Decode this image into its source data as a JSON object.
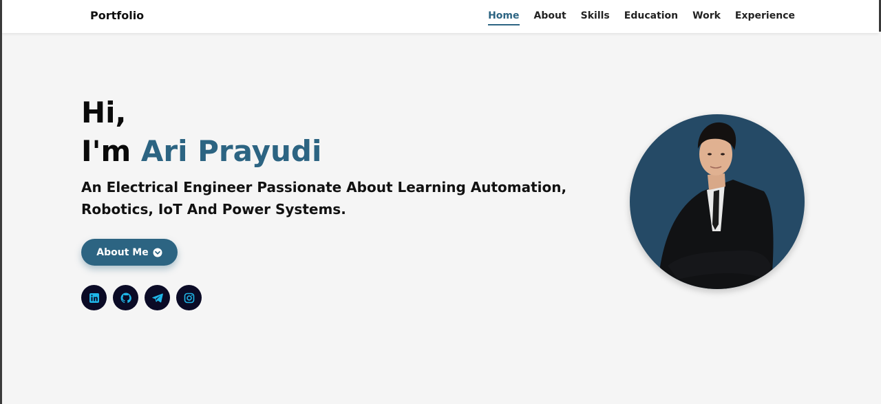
{
  "brand": {
    "logo": "Portfolio"
  },
  "nav": {
    "items": [
      {
        "label": "Home",
        "active": true
      },
      {
        "label": "About"
      },
      {
        "label": "Skills"
      },
      {
        "label": "Education"
      },
      {
        "label": "Work"
      },
      {
        "label": "Experience"
      }
    ]
  },
  "hero": {
    "greeting": "Hi,",
    "intro_prefix": "I'm",
    "name": "Ari Prayudi",
    "tagline": "An Electrical Engineer Passionate About Learning Automation, Robotics, IoT And Power Systems.",
    "cta_label": "About Me",
    "cta_icon": "chevron-circle-down-icon"
  },
  "socials": [
    {
      "icon": "linkedin-icon"
    },
    {
      "icon": "github-icon"
    },
    {
      "icon": "telegram-icon"
    },
    {
      "icon": "instagram-icon"
    }
  ],
  "colors": {
    "accent": "#2c6482",
    "social_bg": "#0b0b26",
    "social_icon": "#1fb6e8",
    "avatar_bg": "#254a66",
    "page_bg": "#f5f5f5"
  }
}
